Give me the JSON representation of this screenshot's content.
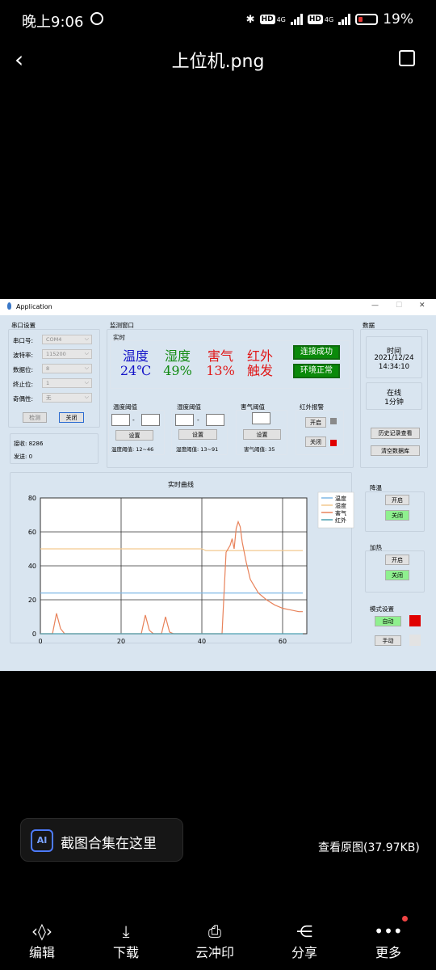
{
  "status_bar": {
    "time": "晚上9:06",
    "net1": "HD",
    "net1_gen": "4G",
    "net2": "HD",
    "net2_gen": "4G",
    "battery": "19%"
  },
  "viewer": {
    "title": "上位机.png",
    "ai_banner": "截图合集在这里",
    "ai_icon": "AI",
    "view_original": "查看原图(37.97KB)",
    "toolbar": [
      {
        "label": "编辑",
        "icon": "edit-icon"
      },
      {
        "label": "下载",
        "icon": "download-icon"
      },
      {
        "label": "云冲印",
        "icon": "print-icon"
      },
      {
        "label": "分享",
        "icon": "share-icon"
      },
      {
        "label": "更多",
        "icon": "more-icon"
      }
    ]
  },
  "app": {
    "window_title": "Application",
    "serial": {
      "group_title": "串口设置",
      "port_label": "串口号:",
      "port_value": "COM4",
      "baud_label": "波特率:",
      "baud_value": "115200",
      "data_label": "数据位:",
      "data_value": "8",
      "stop_label": "终止位:",
      "stop_value": "1",
      "parity_label": "奇偶性:",
      "parity_value": "无",
      "detect_btn": "检测",
      "close_btn": "关闭",
      "recv_label": "接收: 8286",
      "send_label": "发送: 0"
    },
    "monitor": {
      "group_title": "监测窗口",
      "realtime_title": "实时",
      "temp_label": "温度",
      "temp_value": "24℃",
      "hum_label": "湿度",
      "hum_value": "49%",
      "gas_label": "害气",
      "gas_value": "13%",
      "ir_label": "红外",
      "ir_value": "触发",
      "status1": "连接成功",
      "status2": "环境正常",
      "temp_th_title": "温度阈值",
      "hum_th_title": "湿度阈值",
      "gas_th_title": "害气阈值",
      "ir_alarm_title": "红外报警",
      "set_btn": "设置",
      "temp_th_range": "温度阈值: 12~46",
      "hum_th_range": "湿度阈值: 13~91",
      "gas_th_range": "害气阈值: 35",
      "ir_on": "开启",
      "ir_off": "关闭",
      "dash": "-"
    },
    "data_panel": {
      "group_title": "数据",
      "time_label": "时间",
      "date": "2021/12/24",
      "clock": "14:34:10",
      "online_label": "在线",
      "online_value": "1分钟",
      "history_btn": "历史记录查看",
      "clear_btn": "清空数据库"
    },
    "cooling": {
      "title": "降温",
      "on": "开启",
      "off": "关闭"
    },
    "heating": {
      "title": "加热",
      "on": "开启",
      "off": "关闭"
    },
    "mode": {
      "title": "模式设置",
      "auto": "自动",
      "manual": "手动"
    }
  },
  "chart_data": {
    "type": "line",
    "title": "实时曲线",
    "xlim": [
      0,
      66
    ],
    "ylim": [
      0,
      80
    ],
    "xticks": [
      "0",
      "20",
      "40",
      "60"
    ],
    "yticks": [
      "0",
      "20",
      "40",
      "60",
      "80"
    ],
    "legend_position": "top-right",
    "series": [
      {
        "name": "温度",
        "color": "#7fb8e6",
        "x": [
          0,
          65
        ],
        "y": [
          24,
          24
        ]
      },
      {
        "name": "湿度",
        "color": "#f3c98f",
        "x": [
          0,
          40,
          41,
          65
        ],
        "y": [
          50,
          50,
          49,
          49
        ]
      },
      {
        "name": "害气",
        "color": "#e8825a",
        "x": [
          0,
          3,
          4,
          5,
          6,
          7,
          10,
          25,
          26,
          27,
          28,
          30,
          31,
          32,
          33,
          45,
          46,
          47,
          47.5,
          48,
          48.5,
          49,
          49.5,
          50,
          51,
          52,
          53,
          54,
          56,
          58,
          60,
          62,
          64,
          65
        ],
        "y": [
          0,
          0,
          12,
          3,
          0,
          0,
          0,
          0,
          11,
          2,
          0,
          0,
          10,
          1,
          0,
          0,
          48,
          52,
          56,
          50,
          62,
          66,
          63,
          54,
          42,
          32,
          28,
          24,
          20,
          17,
          15,
          14,
          13,
          13
        ]
      },
      {
        "name": "红外",
        "color": "#4a9fb0",
        "x": [
          0,
          65
        ],
        "y": [
          0,
          0
        ]
      }
    ]
  }
}
